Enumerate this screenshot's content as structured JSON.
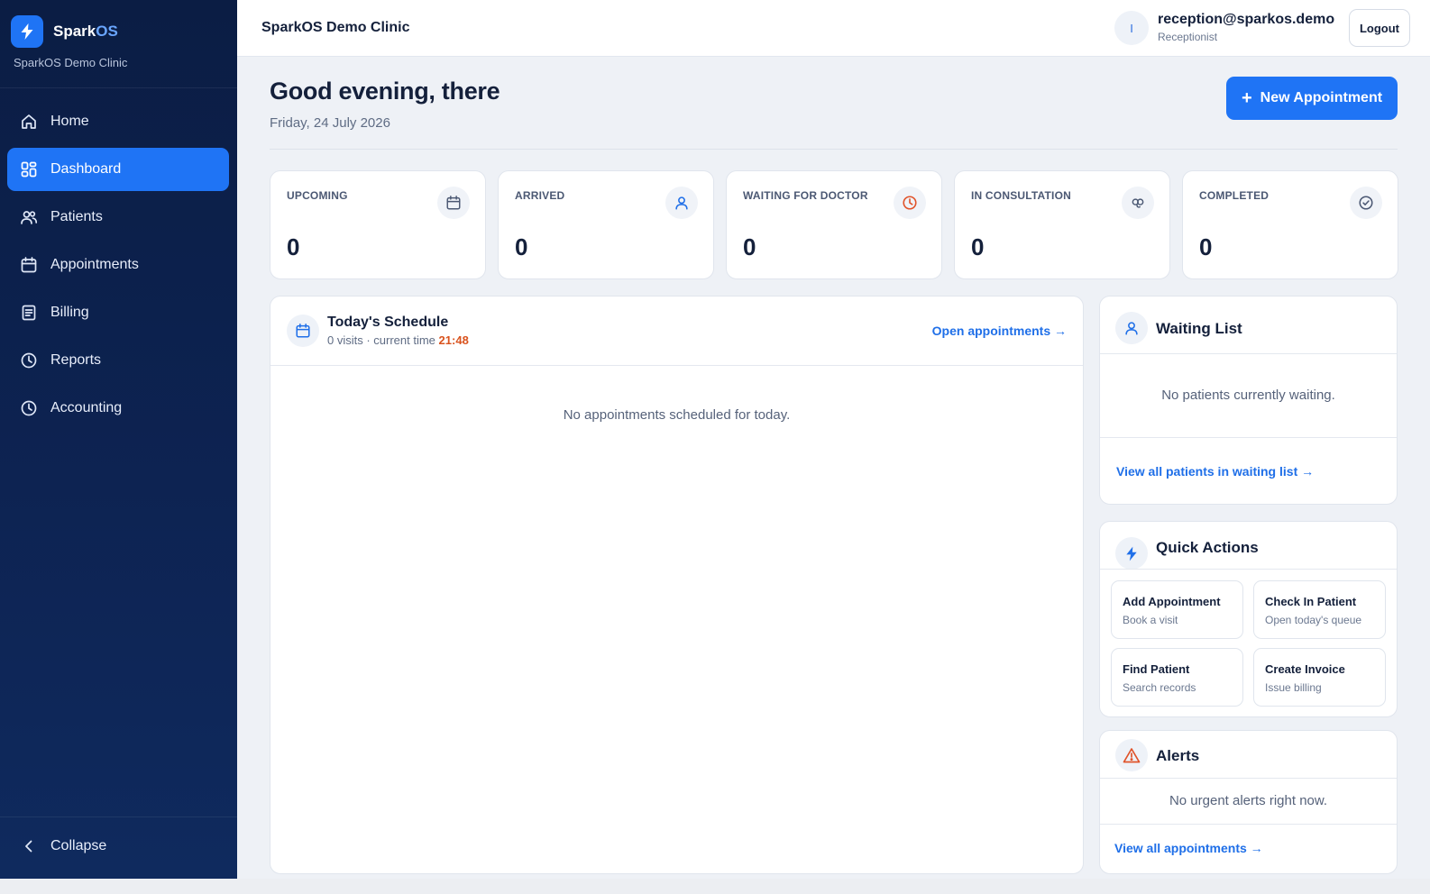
{
  "brand": {
    "name_main": "Spark",
    "name_accent": "OS",
    "clinic": "SparkOS Demo Clinic",
    "accent_color": "#1f74f5"
  },
  "sidebar": {
    "items": [
      {
        "label": "Home",
        "icon": "home-icon"
      },
      {
        "label": "Dashboard",
        "icon": "dashboard-icon",
        "active": true
      },
      {
        "label": "Patients",
        "icon": "users-icon"
      },
      {
        "label": "Appointments",
        "icon": "calendar-icon"
      },
      {
        "label": "Billing",
        "icon": "receipt-icon"
      },
      {
        "label": "Reports",
        "icon": "clock-icon"
      },
      {
        "label": "Accounting",
        "icon": "clock-icon"
      }
    ],
    "collapse_label": "Collapse"
  },
  "topbar": {
    "title": "SparkOS Demo Clinic",
    "avatar_initial": "I",
    "user_email": "reception@sparkos.demo",
    "user_role": "Receptionist",
    "logout_label": "Logout"
  },
  "header": {
    "greeting": "Good evening, there",
    "date": "Friday, 24 July 2026",
    "new_appointment_label": "New Appointment"
  },
  "stats": [
    {
      "label": "UPCOMING",
      "value": "0",
      "icon": "calendar-icon"
    },
    {
      "label": "ARRIVED",
      "value": "0",
      "icon": "user-icon"
    },
    {
      "label": "WAITING FOR DOCTOR",
      "value": "0",
      "icon": "clock-icon"
    },
    {
      "label": "IN CONSULTATION",
      "value": "0",
      "icon": "stethoscope-icon"
    },
    {
      "label": "COMPLETED",
      "value": "0",
      "icon": "check-circle-icon"
    }
  ],
  "schedule": {
    "title": "Today's Schedule",
    "visits_text": "0 visits · current time",
    "current_time": "21:48",
    "link_label": "Open appointments →",
    "empty_text": "No appointments scheduled for today."
  },
  "waiting_list": {
    "title": "Waiting List",
    "empty_text": "No patients currently waiting.",
    "link_label": "View all patients in waiting list →"
  },
  "quick_actions": {
    "title": "Quick Actions",
    "items": [
      {
        "title": "Add Appointment",
        "sub": "Book a visit"
      },
      {
        "title": "Check In Patient",
        "sub": "Open today's queue"
      },
      {
        "title": "Find Patient",
        "sub": "Search records"
      },
      {
        "title": "Create Invoice",
        "sub": "Issue billing"
      }
    ]
  },
  "alerts": {
    "title": "Alerts",
    "empty_text": "No urgent alerts right now.",
    "link_label": "View all appointments →"
  },
  "colors": {
    "sidebar_bg": "#0b1d44",
    "primary": "#1f74f5",
    "link": "#1f6fe8",
    "time_highlight": "#d9531e",
    "warning": "#e0532a"
  }
}
